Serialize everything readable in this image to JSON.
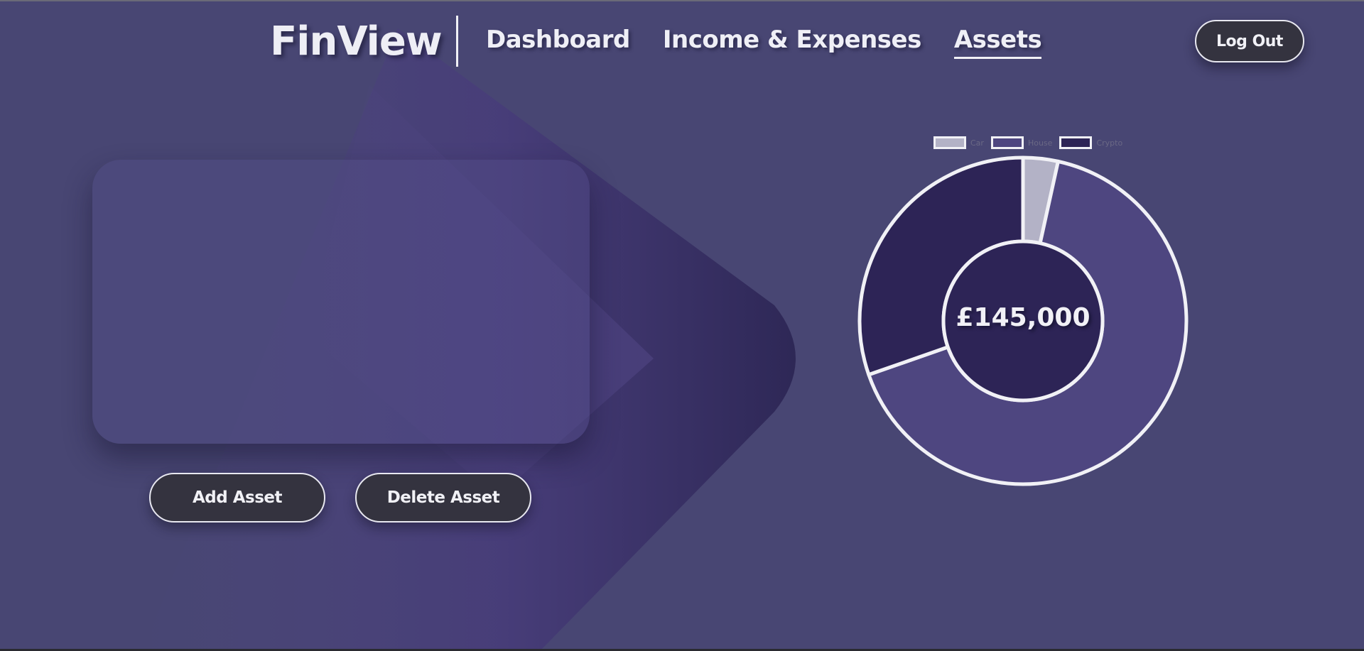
{
  "header": {
    "logo": "FinView",
    "nav": [
      {
        "label": "Dashboard",
        "active": false
      },
      {
        "label": "Income & Expenses",
        "active": false
      },
      {
        "label": "Assets",
        "active": true
      }
    ],
    "logout_label": "Log Out"
  },
  "actions": {
    "add_label": "Add Asset",
    "delete_label": "Delete Asset"
  },
  "chart_data": {
    "type": "pie",
    "donut": true,
    "center_label": "£145,000",
    "legend_position": "top",
    "categories": [
      "Car",
      "House",
      "Crypto"
    ],
    "values": [
      5000,
      96000,
      44000
    ],
    "colors": [
      "#b3b2c6",
      "#4e4680",
      "#2d2456"
    ]
  },
  "colors": {
    "background": "#484673",
    "button": "#34333f",
    "chart_border": "#f1f1f6"
  }
}
